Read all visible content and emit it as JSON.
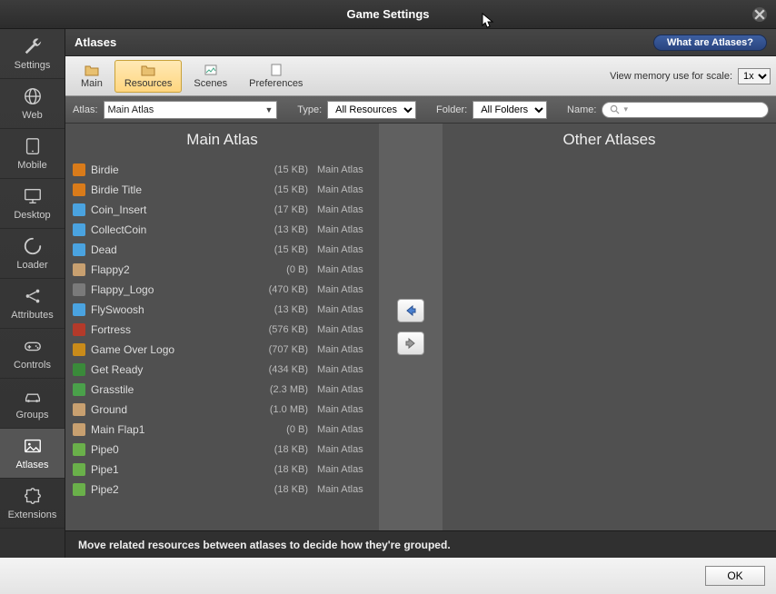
{
  "window": {
    "title": "Game Settings"
  },
  "section": {
    "title": "Atlases",
    "help_label": "What are Atlases?"
  },
  "sidebar": {
    "items": [
      {
        "label": "Settings"
      },
      {
        "label": "Web"
      },
      {
        "label": "Mobile"
      },
      {
        "label": "Desktop"
      },
      {
        "label": "Loader"
      },
      {
        "label": "Attributes"
      },
      {
        "label": "Controls"
      },
      {
        "label": "Groups"
      },
      {
        "label": "Atlases"
      },
      {
        "label": "Extensions"
      }
    ],
    "active_index": 8
  },
  "toolbar": {
    "tabs": [
      {
        "label": "Main"
      },
      {
        "label": "Resources"
      },
      {
        "label": "Scenes"
      },
      {
        "label": "Preferences"
      }
    ],
    "active_index": 1,
    "memory_label": "View memory use for scale:",
    "memory_value": "1x"
  },
  "filter": {
    "atlas_label": "Atlas:",
    "atlas_value": "Main Atlas",
    "type_label": "Type:",
    "type_value": "All Resources",
    "folder_label": "Folder:",
    "folder_value": "All Folders",
    "name_label": "Name:",
    "search_placeholder": ""
  },
  "panes": {
    "left_title": "Main Atlas",
    "right_title": "Other Atlases"
  },
  "resources": [
    {
      "name": "Birdie",
      "size": "(15 KB)",
      "atlas": "Main Atlas",
      "icon_color": "#d97b1a"
    },
    {
      "name": "Birdie Title",
      "size": "(15 KB)",
      "atlas": "Main Atlas",
      "icon_color": "#d97b1a"
    },
    {
      "name": "Coin_Insert",
      "size": "(17 KB)",
      "atlas": "Main Atlas",
      "icon_color": "#4aa3e0"
    },
    {
      "name": "CollectCoin",
      "size": "(13 KB)",
      "atlas": "Main Atlas",
      "icon_color": "#4aa3e0"
    },
    {
      "name": "Dead",
      "size": "(15 KB)",
      "atlas": "Main Atlas",
      "icon_color": "#4aa3e0"
    },
    {
      "name": "Flappy2",
      "size": "(0 B)",
      "atlas": "Main Atlas",
      "icon_color": "#c8a070"
    },
    {
      "name": "Flappy_Logo",
      "size": "(470 KB)",
      "atlas": "Main Atlas",
      "icon_color": "#7a7a7a"
    },
    {
      "name": "FlySwoosh",
      "size": "(13 KB)",
      "atlas": "Main Atlas",
      "icon_color": "#4aa3e0"
    },
    {
      "name": "Fortress",
      "size": "(576 KB)",
      "atlas": "Main Atlas",
      "icon_color": "#b33a2a"
    },
    {
      "name": "Game Over Logo",
      "size": "(707 KB)",
      "atlas": "Main Atlas",
      "icon_color": "#c98b1a"
    },
    {
      "name": "Get Ready",
      "size": "(434 KB)",
      "atlas": "Main Atlas",
      "icon_color": "#3a8a3a"
    },
    {
      "name": "Grasstile",
      "size": "(2.3 MB)",
      "atlas": "Main Atlas",
      "icon_color": "#4aa04a"
    },
    {
      "name": "Ground",
      "size": "(1.0 MB)",
      "atlas": "Main Atlas",
      "icon_color": "#c8a070"
    },
    {
      "name": "Main Flap1",
      "size": "(0 B)",
      "atlas": "Main Atlas",
      "icon_color": "#c8a070"
    },
    {
      "name": "Pipe0",
      "size": "(18 KB)",
      "atlas": "Main Atlas",
      "icon_color": "#6ab04a"
    },
    {
      "name": "Pipe1",
      "size": "(18 KB)",
      "atlas": "Main Atlas",
      "icon_color": "#6ab04a"
    },
    {
      "name": "Pipe2",
      "size": "(18 KB)",
      "atlas": "Main Atlas",
      "icon_color": "#6ab04a"
    }
  ],
  "footer": {
    "message": "Move related resources between atlases to decide how they're grouped."
  },
  "buttons": {
    "ok": "OK"
  }
}
